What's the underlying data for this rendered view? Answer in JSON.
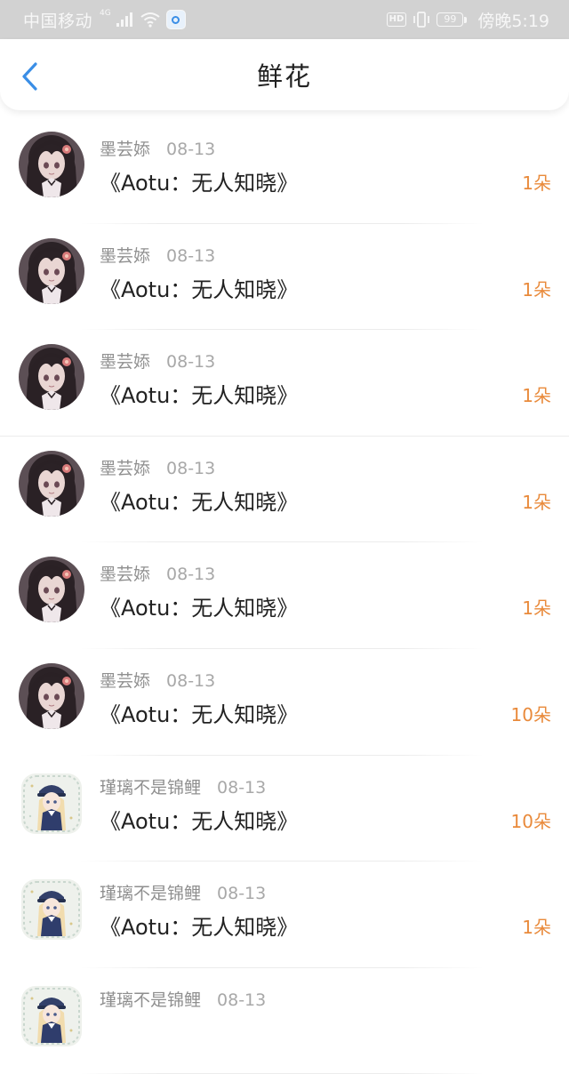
{
  "status_bar": {
    "carrier": "中国移动",
    "network": "4G",
    "hd_label": "HD",
    "battery": "99",
    "time": "傍晚5:19"
  },
  "nav": {
    "title": "鲜花",
    "back_icon": "chevron-left-icon",
    "accent_color": "#3a8ee6"
  },
  "count_color": "#e98a3b",
  "items": [
    {
      "user": "墨芸婖",
      "date": "08-13",
      "title": "《Aotu：无人知晓》",
      "count": "1朵",
      "avatar": "dark-hair-girl"
    },
    {
      "user": "墨芸婖",
      "date": "08-13",
      "title": "《Aotu：无人知晓》",
      "count": "1朵",
      "avatar": "dark-hair-girl"
    },
    {
      "user": "墨芸婖",
      "date": "08-13",
      "title": "《Aotu：无人知晓》",
      "count": "1朵",
      "avatar": "dark-hair-girl"
    },
    {
      "user": "墨芸婖",
      "date": "08-13",
      "title": "《Aotu：无人知晓》",
      "count": "1朵",
      "avatar": "dark-hair-girl"
    },
    {
      "user": "墨芸婖",
      "date": "08-13",
      "title": "《Aotu：无人知晓》",
      "count": "1朵",
      "avatar": "dark-hair-girl"
    },
    {
      "user": "墨芸婖",
      "date": "08-13",
      "title": "《Aotu：无人知晓》",
      "count": "10朵",
      "avatar": "dark-hair-girl"
    },
    {
      "user": "瑾璃不是锦鲤",
      "date": "08-13",
      "title": "《Aotu：无人知晓》",
      "count": "10朵",
      "avatar": "blonde-sailor-girl"
    },
    {
      "user": "瑾璃不是锦鲤",
      "date": "08-13",
      "title": "《Aotu：无人知晓》",
      "count": "1朵",
      "avatar": "blonde-sailor-girl"
    },
    {
      "user": "瑾璃不是锦鲤",
      "date": "08-13",
      "title": "",
      "count": "",
      "avatar": "blonde-sailor-girl"
    }
  ]
}
